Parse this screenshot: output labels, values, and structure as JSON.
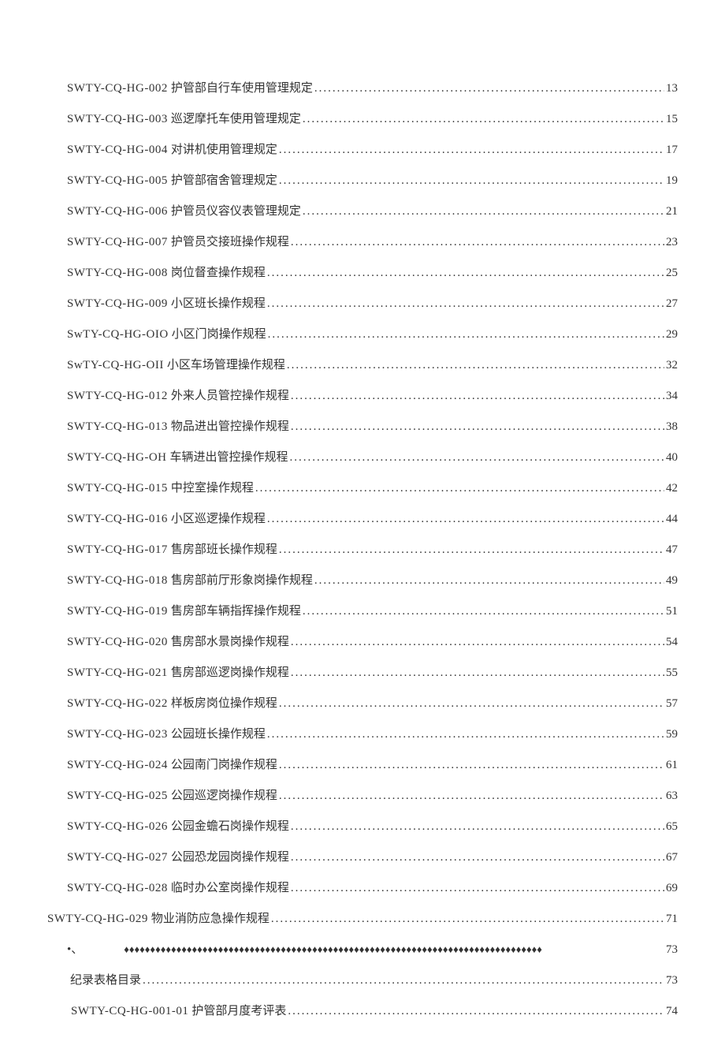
{
  "toc": [
    {
      "code": "SWTY-CQ-HG-002",
      "title": "护管部自行车使用管理规定",
      "page": "13",
      "indent": "indent"
    },
    {
      "code": "SWTY-CQ-HG-003",
      "title": "巡逻摩托车使用管理规定",
      "page": "15",
      "indent": "indent"
    },
    {
      "code": "SWTY-CQ-HG-004",
      "title": "对讲机使用管理规定",
      "page": "17",
      "indent": "indent"
    },
    {
      "code": "SWTY-CQ-HG-005",
      "title": "护管部宿舍管理规定",
      "page": "19",
      "indent": "indent"
    },
    {
      "code": "SWTY-CQ-HG-006",
      "title": "护管员仪容仪表管理规定",
      "page": "21",
      "indent": "indent"
    },
    {
      "code": "SWTY-CQ-HG-007",
      "title": "护管员交接班操作规程",
      "page": "23",
      "indent": "indent"
    },
    {
      "code": "SWTY-CQ-HG-008",
      "title": "岗位督查操作规程",
      "page": "25",
      "indent": "indent"
    },
    {
      "code": "SWTY-CQ-HG-009",
      "title": "小区班长操作规程",
      "page": "27",
      "indent": "indent"
    },
    {
      "code": "SwTY-CQ-HG-OIO",
      "title": "小区门岗操作规程 ",
      "page": "29",
      "indent": "indent"
    },
    {
      "code": "SwTY-CQ-HG-OII",
      "title": "小区车场管理操作规程 ",
      "page": "32",
      "indent": "indent"
    },
    {
      "code": "SWTY-CQ-HG-012",
      "title": "外来人员管控操作规程 ",
      "page": "34",
      "indent": "indent"
    },
    {
      "code": "SWTY-CQ-HG-013",
      "title": "物品进出管控操作规程 ",
      "page": "38",
      "indent": "indent"
    },
    {
      "code": "SWTY-CQ-HG-OH",
      "title": "车辆进出管控操作规程",
      "page": "40",
      "indent": "indent"
    },
    {
      "code": "SWTY-CQ-HG-015",
      "title": "中控室操作规程",
      "page": "42",
      "indent": "indent"
    },
    {
      "code": "SWTY-CQ-HG-016",
      "title": "小区巡逻操作规程",
      "page": "44",
      "indent": "indent"
    },
    {
      "code": "SWTY-CQ-HG-017",
      "title": "售房部班长操作规程",
      "page": "47",
      "indent": "indent"
    },
    {
      "code": "SWTY-CQ-HG-018",
      "title": "售房部前厅形象岗操作规程",
      "page": "49",
      "indent": "indent"
    },
    {
      "code": "SWTY-CQ-HG-019",
      "title": "售房部车辆指挥操作规程",
      "page": "51",
      "indent": "indent"
    },
    {
      "code": "SWTY-CQ-HG-020",
      "title": "售房部水景岗操作规程",
      "page": "54",
      "indent": "indent"
    },
    {
      "code": "SWTY-CQ-HG-021",
      "title": "售房部巡逻岗操作规程",
      "page": "55",
      "indent": "indent"
    },
    {
      "code": "SWTY-CQ-HG-022",
      "title": "样板房岗位操作规程",
      "page": "57",
      "indent": "indent"
    },
    {
      "code": "SWTY-CQ-HG-023",
      "title": "公园班长操作规程",
      "page": "59",
      "indent": "indent"
    },
    {
      "code": "SWTY-CQ-HG-024",
      "title": "公园南门岗操作规程",
      "page": "61",
      "indent": "indent"
    },
    {
      "code": "SWTY-CQ-HG-025",
      "title": "公园巡逻岗操作规程",
      "page": "63",
      "indent": "indent"
    },
    {
      "code": "SWTY-CQ-HG-026",
      "title": "公园金蟾石岗操作规程",
      "page": "65",
      "indent": "indent"
    },
    {
      "code": "SWTY-CQ-HG-027",
      "title": "公园恐龙园岗操作规程",
      "page": "67",
      "indent": "indent"
    },
    {
      "code": "SWTY-CQ-HG-028",
      "title": "临时办公室岗操作规程",
      "page": "69",
      "indent": "indent"
    },
    {
      "code": "SWTY-CQ-HG-029",
      "title": "物业消防应急操作规程 ",
      "page": "71",
      "indent": "noindent"
    }
  ],
  "diamond_row": {
    "lead": "•、",
    "page": "73"
  },
  "tail": [
    {
      "title": "纪录表格目录",
      "page": "73",
      "indent": "indent"
    },
    {
      "code": "SWTY-CQ-HG-001-01",
      "title": "护管部月度考评表",
      "page": "74",
      "indent": "indent2"
    }
  ]
}
